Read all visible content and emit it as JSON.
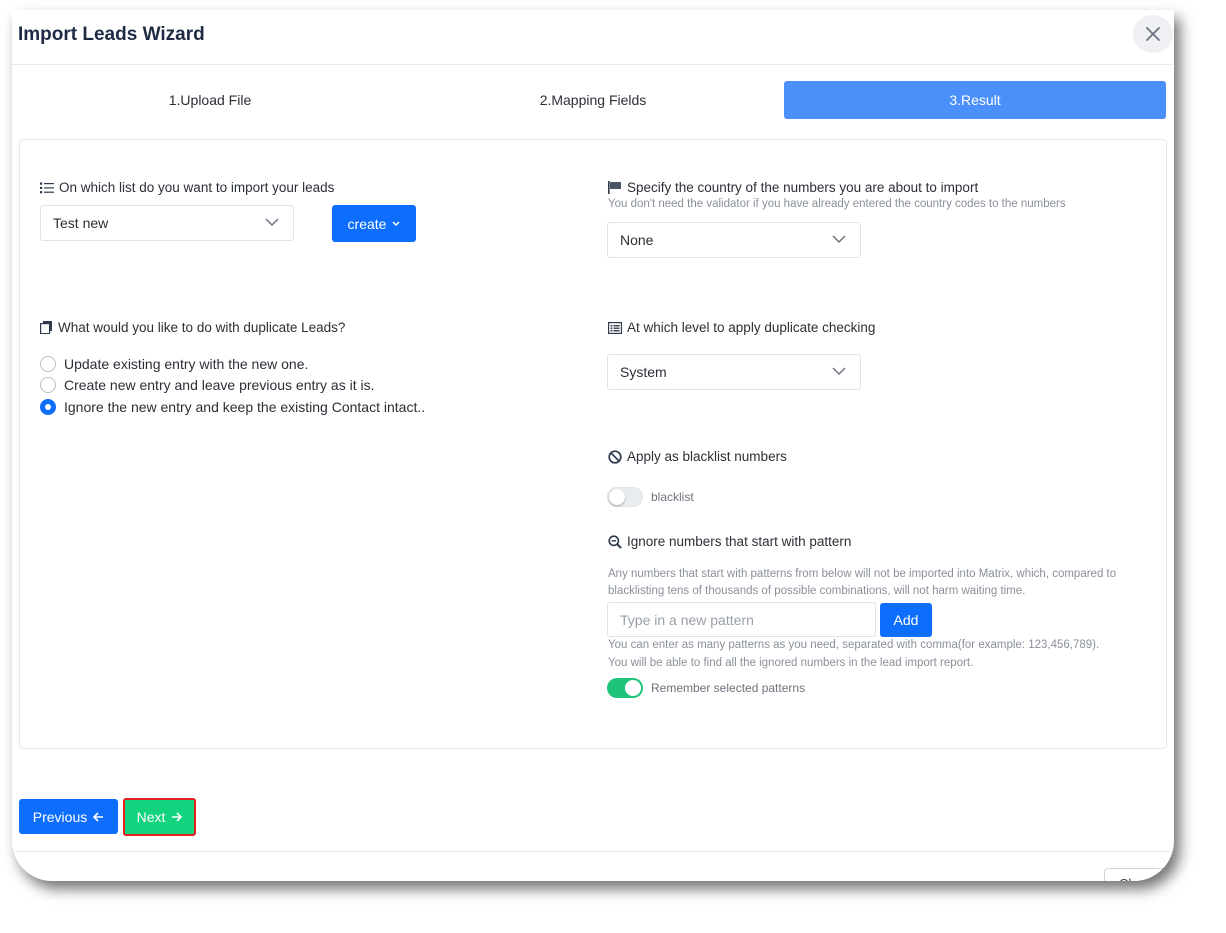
{
  "title": "Import Leads Wizard",
  "steps": [
    {
      "label": "1.Upload File"
    },
    {
      "label": "2.Mapping Fields"
    },
    {
      "label": "3.Result"
    }
  ],
  "list": {
    "label": "On which list do you want to import your leads",
    "selected": "Test new",
    "create_label": "create"
  },
  "country": {
    "label": "Specify the country of the numbers you are about to import",
    "hint": "You don't need the validator if you have already entered the country codes to the numbers",
    "selected": "None"
  },
  "duplicates": {
    "label": "What would you like to do with duplicate Leads?",
    "options": [
      {
        "label": "Update existing entry with the new one.",
        "checked": false
      },
      {
        "label": "Create new entry and leave previous entry as it is.",
        "checked": false
      },
      {
        "label": "Ignore the new entry and keep the existing Contact intact..",
        "checked": true
      }
    ]
  },
  "level": {
    "label": "At which level to apply duplicate checking",
    "selected": "System"
  },
  "blacklist": {
    "label": "Apply as blacklist numbers",
    "toggle_label": "blacklist",
    "enabled": false
  },
  "pattern": {
    "label": "Ignore numbers that start with pattern",
    "hint_line1": "Any numbers that start with patterns from below will not be imported into Matrix, which, compared to",
    "hint_line2": "blacklisting tens of thousands of possible combinations, will not harm waiting time.",
    "placeholder": "Type in a new pattern",
    "add_label": "Add",
    "note_line1": "You can enter as many patterns as you need, separated with comma(for example: 123,456,789).",
    "note_line2": "You will be able to find all the ignored numbers in the lead import report.",
    "remember_label": "Remember selected patterns",
    "remember_enabled": true
  },
  "footer": {
    "previous_label": "Previous",
    "next_label": "Next",
    "close_label": "Cl"
  },
  "colors": {
    "primary": "#0d6efd",
    "active_step": "#4b8ffa",
    "success": "#12d37e",
    "toggle_on": "#1fc47a"
  }
}
